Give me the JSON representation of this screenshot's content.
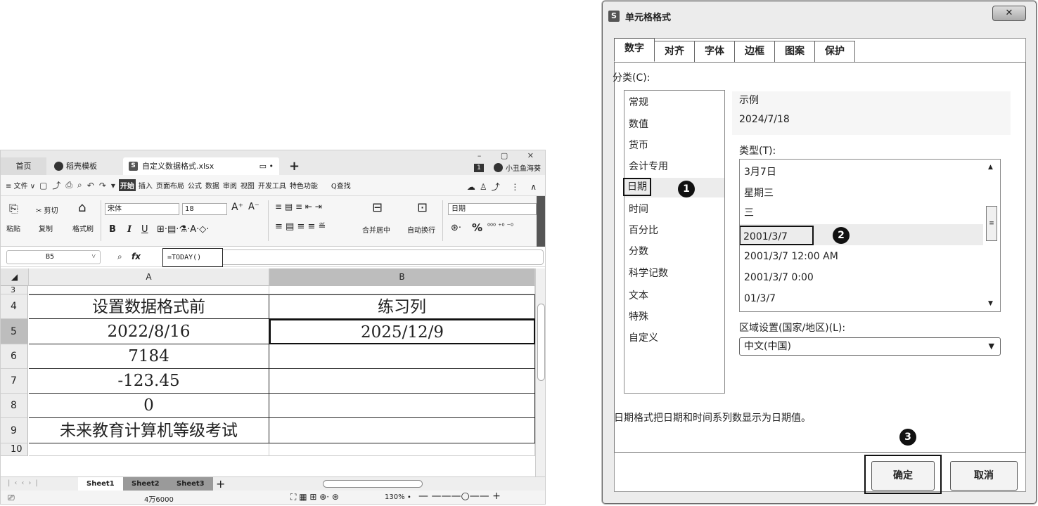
{
  "spreadsheet": {
    "tabs": {
      "home": "首页",
      "template": "稻壳模板",
      "file": "自定义数据格式.xlsx",
      "plus": "+"
    },
    "window_controls": "– ▢ ✕",
    "user": "小丑鱼海葵",
    "notif_badge": "1",
    "menu": {
      "file": "≡ 文件 ∨",
      "items": [
        "开始",
        "插入",
        "页面布局",
        "公式",
        "数据",
        "审阅",
        "视图",
        "开发工具",
        "特色功能"
      ],
      "active": "开始",
      "search": "Q查找"
    },
    "ribbon": {
      "paste": "粘贴",
      "cut": "✂ 剪切",
      "copy": "复制",
      "format_painter": "格式刷",
      "font": "宋体",
      "size": "18",
      "grow_font": "A⁺",
      "shrink_font": "A⁻",
      "bold": "B",
      "italic": "I",
      "underline": "U",
      "merge": "合并居中",
      "wrap": "自动换行",
      "number_format": "日期",
      "percent": "%"
    },
    "formula_bar": {
      "name_box": "B5",
      "fx": "fx",
      "formula": "=TODAY()"
    },
    "columns": [
      "A",
      "B"
    ],
    "rows": [
      {
        "num": "3",
        "a": "",
        "b": ""
      },
      {
        "num": "4",
        "a": "设置数据格式前",
        "b": "练习列"
      },
      {
        "num": "5",
        "a": "2022/8/16",
        "b": "2025/12/9"
      },
      {
        "num": "6",
        "a": "7184",
        "b": ""
      },
      {
        "num": "7",
        "a": "-123.45",
        "b": ""
      },
      {
        "num": "8",
        "a": "0",
        "b": ""
      },
      {
        "num": "9",
        "a": "未来教育计算机等级考试",
        "b": ""
      },
      {
        "num": "10",
        "a": "",
        "b": ""
      }
    ],
    "sheets": [
      "Sheet1",
      "Sheet2",
      "Sheet3"
    ],
    "status": {
      "count": "4万6000",
      "zoom": "130% ∙"
    }
  },
  "dialog": {
    "title": "单元格格式",
    "close": "✕",
    "tabs": [
      "数字",
      "对齐",
      "字体",
      "边框",
      "图案",
      "保护"
    ],
    "category_label": "分类(C):",
    "categories": [
      "常规",
      "数值",
      "货币",
      "会计专用",
      "日期",
      "时间",
      "百分比",
      "分数",
      "科学记数",
      "文本",
      "特殊",
      "自定义"
    ],
    "selected_category": "日期",
    "sample_label": "示例",
    "sample_value": "2024/7/18",
    "type_label": "类型(T):",
    "types": [
      "3月7日",
      "星期三",
      "三",
      "2001/3/7",
      "2001/3/7 12:00 AM",
      "2001/3/7 0:00",
      "01/3/7"
    ],
    "selected_type": "2001/3/7",
    "region_label": "区域设置(国家/地区)(L):",
    "region_value": "中文(中国)",
    "description": "日期格式把日期和时间系列数显示为日期值。",
    "ok": "确定",
    "cancel": "取消",
    "markers": [
      "1",
      "2",
      "3"
    ]
  }
}
